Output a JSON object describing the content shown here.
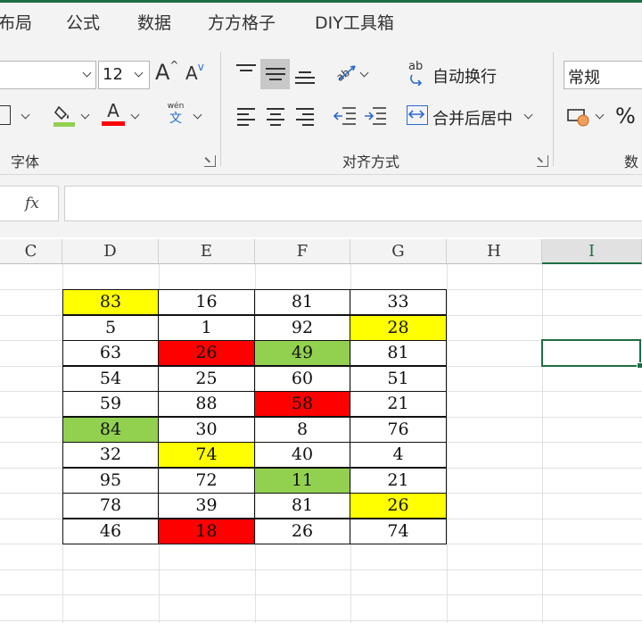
{
  "menu_tabs": [
    "布局",
    "公式",
    "数据",
    "方方格子",
    "DIY工具箱"
  ],
  "ribbon": {
    "font_size": "12",
    "font_group_label": "字体",
    "align_group_label": "对齐方式",
    "number_group_label": "数",
    "wrap_text": "自动换行",
    "merge_center": "合并后居中",
    "number_format": "常规",
    "percent": "%",
    "phonetic": "wén",
    "phonetic_char": "文",
    "wrap_icon_text": "ab",
    "font_color_letter": "A",
    "grow_font": "A",
    "shrink_font": "A"
  },
  "formula_bar": {
    "fx": "fx",
    "value": ""
  },
  "columns": [
    "C",
    "D",
    "E",
    "F",
    "G",
    "H",
    "I"
  ],
  "active_column": "I",
  "colors": {
    "yellow": "#ffff00",
    "red": "#ff0000",
    "green": "#92d050",
    "accent": "#1e6e43"
  },
  "table": {
    "columns": [
      "D",
      "E",
      "F",
      "G"
    ],
    "rows": [
      [
        {
          "v": "83",
          "c": "yellow"
        },
        {
          "v": "16"
        },
        {
          "v": "81"
        },
        {
          "v": "33"
        }
      ],
      [
        {
          "v": "5"
        },
        {
          "v": "1"
        },
        {
          "v": "92"
        },
        {
          "v": "28",
          "c": "yellow"
        }
      ],
      [
        {
          "v": "63"
        },
        {
          "v": "26",
          "c": "red"
        },
        {
          "v": "49",
          "c": "green"
        },
        {
          "v": "81"
        }
      ],
      [
        {
          "v": "54"
        },
        {
          "v": "25"
        },
        {
          "v": "60"
        },
        {
          "v": "51"
        }
      ],
      [
        {
          "v": "59"
        },
        {
          "v": "88"
        },
        {
          "v": "58",
          "c": "red"
        },
        {
          "v": "21"
        }
      ],
      [
        {
          "v": "84",
          "c": "green"
        },
        {
          "v": "30"
        },
        {
          "v": "8"
        },
        {
          "v": "76"
        }
      ],
      [
        {
          "v": "32"
        },
        {
          "v": "74",
          "c": "yellow"
        },
        {
          "v": "40"
        },
        {
          "v": "4"
        }
      ],
      [
        {
          "v": "95"
        },
        {
          "v": "72"
        },
        {
          "v": "11",
          "c": "green"
        },
        {
          "v": "21"
        }
      ],
      [
        {
          "v": "78"
        },
        {
          "v": "39"
        },
        {
          "v": "81"
        },
        {
          "v": "26",
          "c": "yellow"
        }
      ],
      [
        {
          "v": "46"
        },
        {
          "v": "18",
          "c": "red"
        },
        {
          "v": "26"
        },
        {
          "v": "74"
        }
      ]
    ]
  }
}
